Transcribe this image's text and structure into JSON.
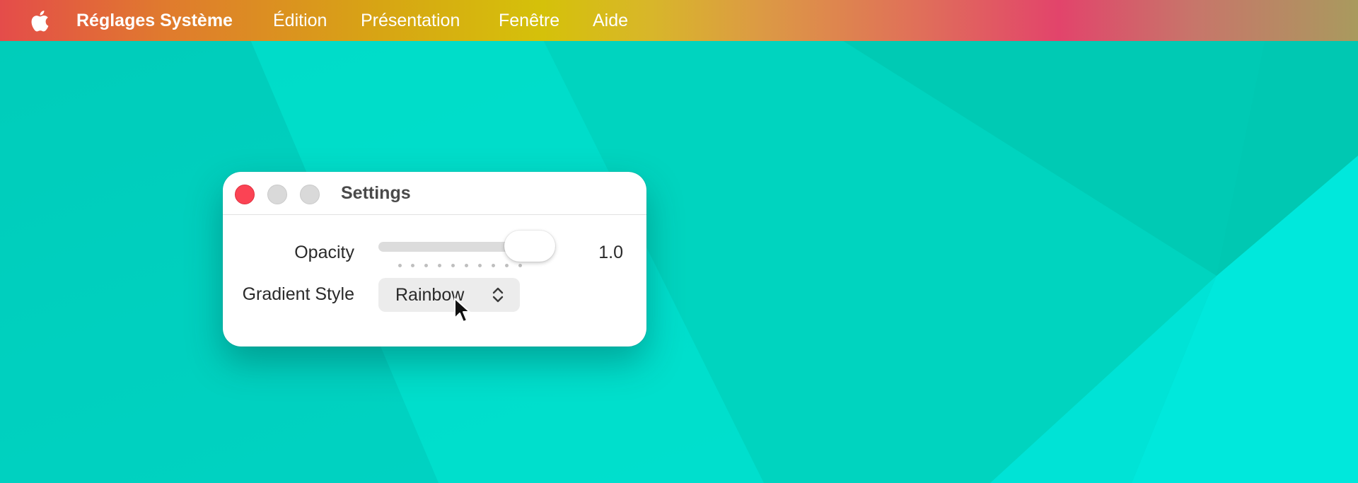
{
  "menubar": {
    "apple_icon": "apple-logo-icon",
    "app_name": "Réglages Système",
    "items": [
      {
        "label": "Édition"
      },
      {
        "label": "Présentation"
      },
      {
        "label": "Fenêtre"
      },
      {
        "label": "Aide"
      }
    ]
  },
  "window": {
    "title": "Settings",
    "controls": {
      "close_color": "#fb4354",
      "inactive_color": "#d9d9d9"
    },
    "opacity": {
      "label": "Opacity",
      "value_text": "1.0",
      "value": 1.0,
      "min": 0,
      "max": 1,
      "tick_count": 10
    },
    "gradient_style": {
      "label": "Gradient Style",
      "selected": "Rainbow",
      "icon": "chevron-updown-icon"
    }
  },
  "colors": {
    "desktop": "#00d7c1",
    "menubar_gradient": [
      "#e44c4a",
      "#d7a514",
      "#d5c10a",
      "#e2446b",
      "#a99a5e"
    ]
  },
  "cursor": "arrow-pointer-icon"
}
